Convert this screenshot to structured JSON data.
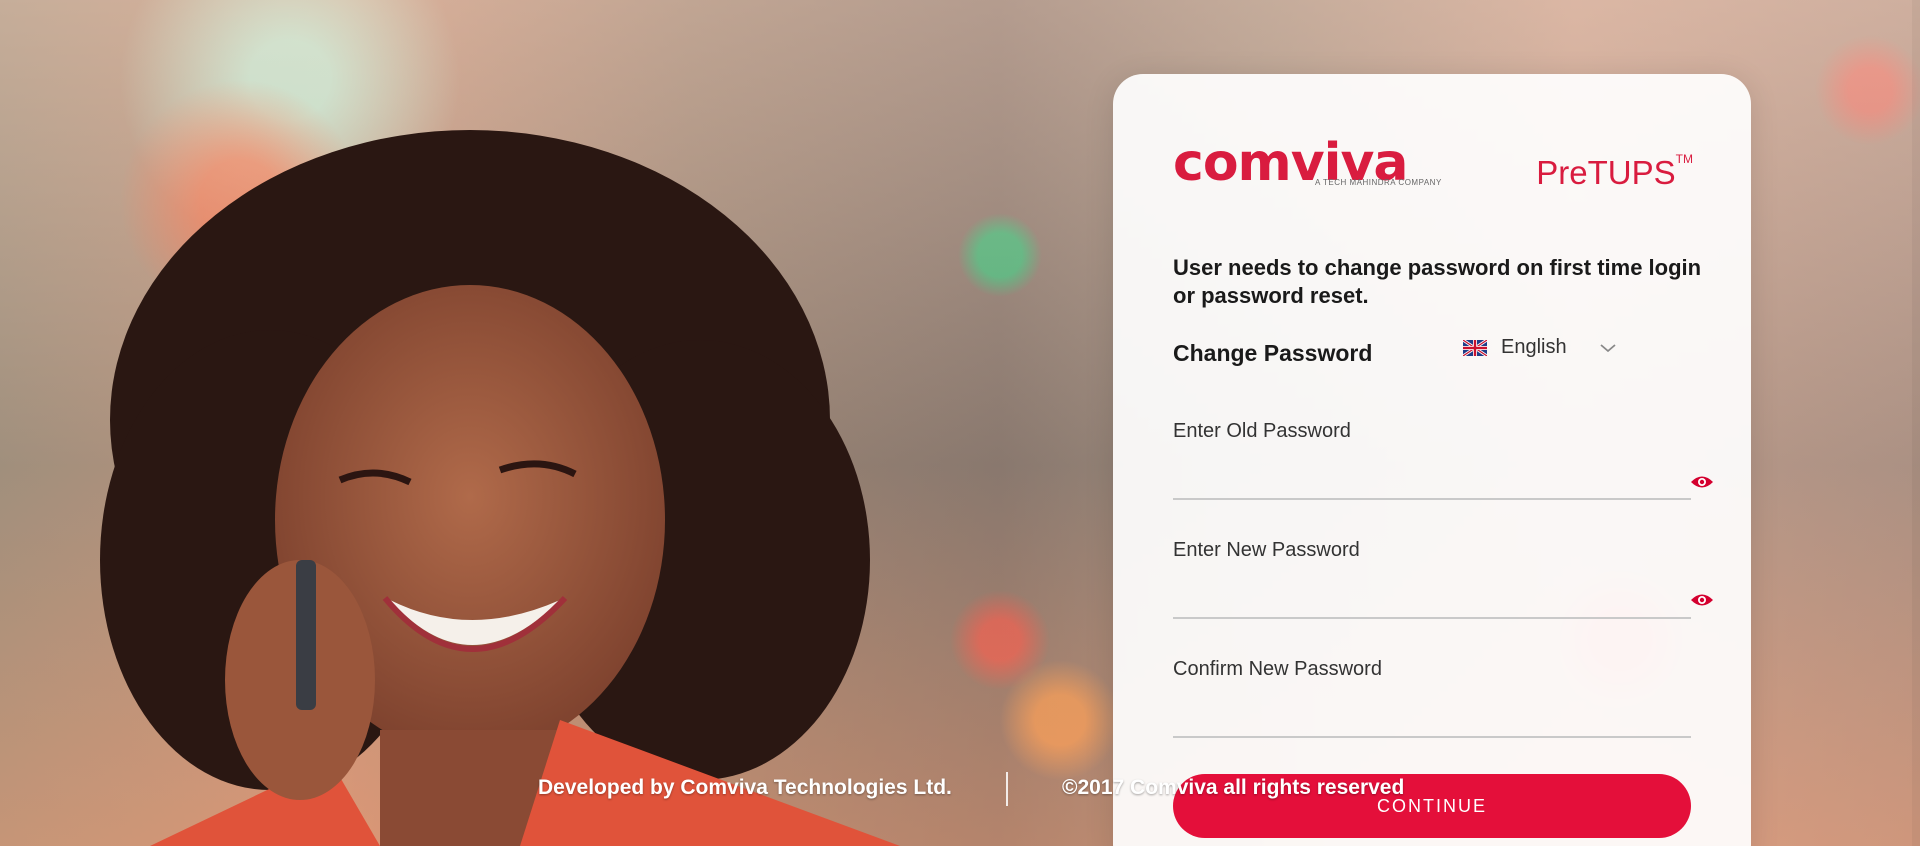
{
  "brand": {
    "logo_text": "comviva",
    "logo_tagline": "A TECH MAHINDRA COMPANY",
    "product_name": "PreTUPS",
    "product_mark": "TM"
  },
  "form": {
    "notice": "User needs to change password on first time login or password reset.",
    "title": "Change Password",
    "language": "English",
    "fields": [
      {
        "label": "Enter Old Password",
        "value": ""
      },
      {
        "label": "Enter New Password",
        "value": ""
      },
      {
        "label": "Confirm New Password",
        "value": ""
      }
    ],
    "submit_label": "CONTINUE"
  },
  "footer": {
    "developer": "Developed by Comviva Technologies Ltd.",
    "copyright": "©2017 Comviva all rights reserved"
  },
  "colors": {
    "accent": "#e40f3a",
    "brand": "#d91c3f"
  }
}
